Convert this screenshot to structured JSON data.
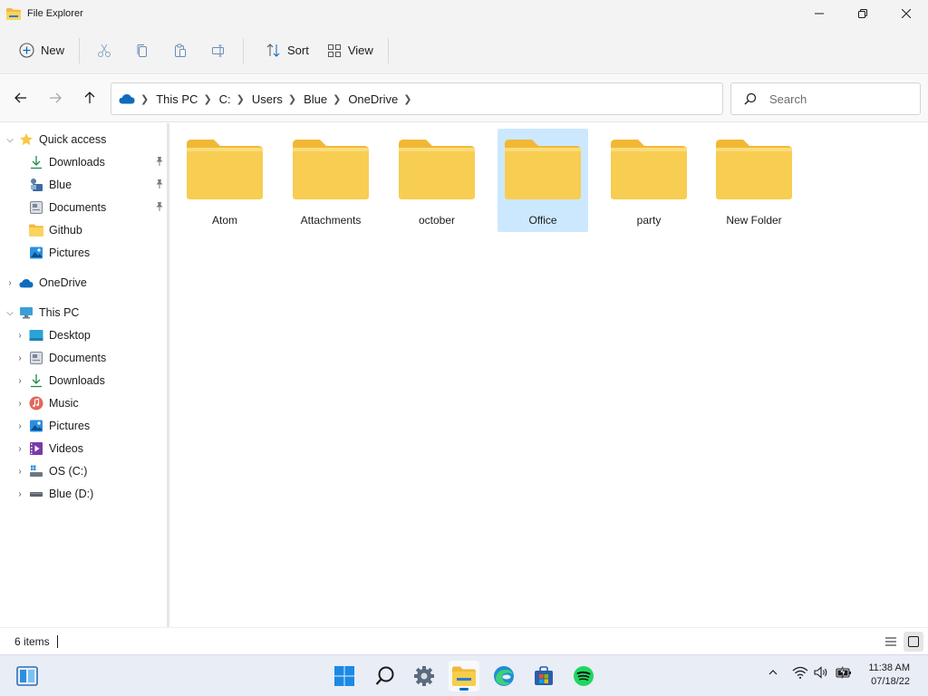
{
  "window": {
    "title": "File Explorer"
  },
  "toolbar": {
    "new_label": "New",
    "sort_label": "Sort",
    "view_label": "View"
  },
  "breadcrumb": [
    "This PC",
    "C:",
    "Users",
    "Blue",
    "OneDrive"
  ],
  "search": {
    "placeholder": "Search"
  },
  "sidebar": {
    "quick_access": {
      "label": "Quick access",
      "items": [
        {
          "label": "Downloads",
          "pinned": true
        },
        {
          "label": "Blue",
          "pinned": true
        },
        {
          "label": "Documents",
          "pinned": true
        },
        {
          "label": "Github",
          "pinned": false
        },
        {
          "label": "Pictures",
          "pinned": false
        }
      ]
    },
    "onedrive": {
      "label": "OneDrive"
    },
    "this_pc": {
      "label": "This PC",
      "items": [
        {
          "label": "Desktop"
        },
        {
          "label": "Documents"
        },
        {
          "label": "Downloads"
        },
        {
          "label": "Music"
        },
        {
          "label": "Pictures"
        },
        {
          "label": "Videos"
        },
        {
          "label": "OS (C:)"
        },
        {
          "label": "Blue (D:)"
        }
      ]
    }
  },
  "folders": [
    {
      "name": "Atom",
      "selected": false
    },
    {
      "name": "Attachments",
      "selected": false
    },
    {
      "name": "october",
      "selected": false
    },
    {
      "name": "Office",
      "selected": true
    },
    {
      "name": "party",
      "selected": false
    },
    {
      "name": "New Folder",
      "selected": false
    }
  ],
  "status": {
    "item_count": "6 items"
  },
  "clock": {
    "time": "11:38 AM",
    "date": "07/18/22"
  },
  "colors": {
    "accent": "#0067c0",
    "selection": "#cce8ff",
    "folder": "#f8cd4a"
  }
}
